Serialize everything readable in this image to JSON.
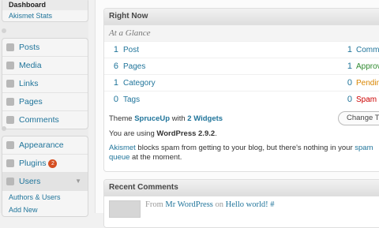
{
  "sidebar": {
    "dashboard_submenu": [
      "Dashboard",
      "Akismet Stats"
    ],
    "content_menu": [
      {
        "label": "Posts",
        "icon": "pin-icon"
      },
      {
        "label": "Media",
        "icon": "media-icon"
      },
      {
        "label": "Links",
        "icon": "link-icon"
      },
      {
        "label": "Pages",
        "icon": "page-icon"
      },
      {
        "label": "Comments",
        "icon": "comment-icon"
      }
    ],
    "appearance": {
      "label": "Appearance",
      "icon": "appearance-icon"
    },
    "plugins": {
      "label": "Plugins",
      "badge": "2",
      "icon": "plugin-icon"
    },
    "users": {
      "label": "Users",
      "icon": "users-icon",
      "submenu": [
        "Authors & Users",
        "Add New"
      ]
    }
  },
  "right_now": {
    "title": "Right Now",
    "at_a_glance": "At a Glance",
    "content": [
      {
        "count": "1",
        "label": "Post"
      },
      {
        "count": "6",
        "label": "Pages"
      },
      {
        "count": "1",
        "label": "Category"
      },
      {
        "count": "0",
        "label": "Tags"
      }
    ],
    "discussion": [
      {
        "count": "1",
        "label": "Comme",
        "status": "neutral"
      },
      {
        "count": "1",
        "label": "Approv",
        "status": "approved"
      },
      {
        "count": "0",
        "label": "Pendin",
        "status": "pending"
      },
      {
        "count": "0",
        "label": "Spam",
        "status": "spam"
      }
    ],
    "theme": {
      "prefix": "Theme ",
      "name": "SpruceUp",
      "mid": " with ",
      "widgets": "2 Widgets"
    },
    "change_theme_button": "Change Th",
    "version": {
      "prefix": "You are using ",
      "value": "WordPress 2.9.2",
      "suffix": "."
    },
    "akismet": {
      "link": "Akismet",
      "text": " blocks spam from getting to your blog, but there's nothing in your ",
      "spam_link": "spam",
      "queue_link": "queue",
      "tail": " at the moment."
    }
  },
  "recent_comments": {
    "title": "Recent Comments",
    "first": {
      "from": "From ",
      "author": "Mr WordPress",
      "on": " on ",
      "post": "Hello world!",
      "hash": " #"
    }
  },
  "colors": {
    "link": "#21759b",
    "approved": "#2f8a2f",
    "pending": "#d98500",
    "spam": "#cc0000",
    "badge": "#d54e21"
  }
}
